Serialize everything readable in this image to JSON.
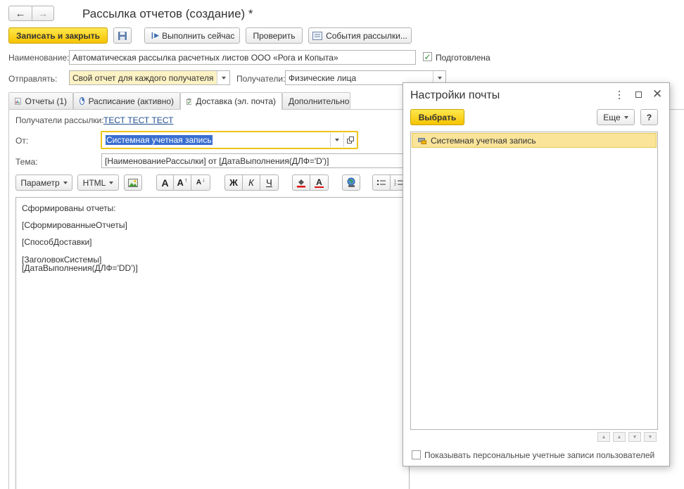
{
  "window": {
    "title": "Рассылка отчетов (создание) *"
  },
  "toolbar": {
    "save_close": "Записать и закрыть",
    "run_now": "Выполнить сейчас",
    "check": "Проверить",
    "events": "События рассылки..."
  },
  "form": {
    "name_label": "Наименование:",
    "name_value": "Автоматическая рассылка расчетных листов ООО «Рога и Копыта»",
    "prepared_label": "Подготовлена",
    "prepared_checked": true,
    "send_label": "Отправлять:",
    "send_value": "Свой отчет для каждого получателя",
    "recipients_label": "Получатели:",
    "recipients_value": "Физические лица"
  },
  "tabs": [
    {
      "label": "Отчеты (1)"
    },
    {
      "label": "Расписание (активно)"
    },
    {
      "label": "Доставка (эл. почта)"
    },
    {
      "label": "Дополнительно"
    }
  ],
  "delivery": {
    "recipients_label": "Получатели рассылки:",
    "recipients_link": "ТЕСТ ТЕСТ ТЕСТ",
    "from_label": "От:",
    "from_value": "Системная учетная запись",
    "subject_label": "Тема:",
    "subject_value": "[НаименованиеРассылки] от [ДатаВыполнения(ДЛФ='D')]"
  },
  "editor_toolbar": {
    "param": "Параметр",
    "html": "HTML",
    "font_a": "A",
    "bold": "Ж",
    "italic": "К",
    "underline": "Ч"
  },
  "body_lines": [
    "Сформированы отчеты:",
    "[СформированныеОтчеты]",
    "[СпособДоставки]",
    "[ЗаголовокСистемы]",
    "[ДатаВыполнения(ДЛФ='DD')]"
  ],
  "popup": {
    "title": "Настройки почты",
    "select": "Выбрать",
    "more": "Еще",
    "help": "?",
    "list_items": [
      "Системная учетная запись"
    ],
    "show_personal": "Показывать персональные учетные записи пользователей",
    "show_personal_checked": false
  }
}
